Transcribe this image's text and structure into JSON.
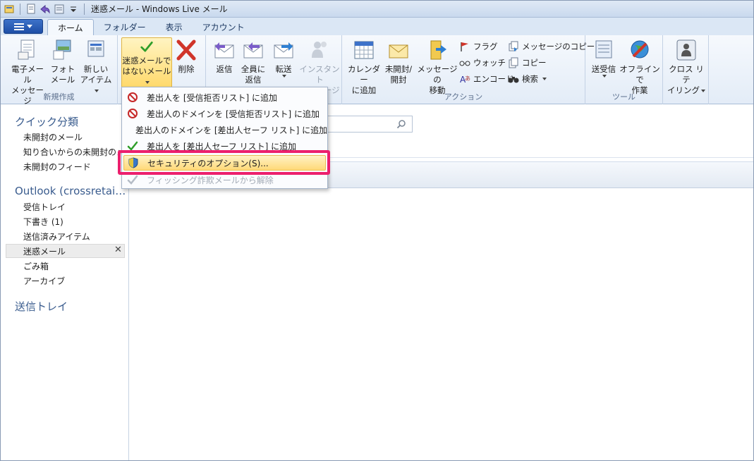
{
  "window": {
    "title": "迷惑メール - Windows Live メール"
  },
  "tabs": [
    {
      "label": "ホーム",
      "active": true
    },
    {
      "label": "フォルダー",
      "active": false
    },
    {
      "label": "表示",
      "active": false
    },
    {
      "label": "アカウント",
      "active": false
    }
  ],
  "ribbon": {
    "new_group": {
      "label": "新規作成",
      "email_line1": "電子メール",
      "email_line2": "メッセージ",
      "photo_line1": "フォト",
      "photo_line2": "メール",
      "newitem_line1": "新しい",
      "newitem_line2": "アイテム"
    },
    "delete_group": {
      "notjunk_line1": "迷惑メールで",
      "notjunk_line2": "はないメール",
      "delete": "削除"
    },
    "respond_group": {
      "reply": "返信",
      "replyall_line1": "全員に",
      "replyall_line2": "返信",
      "forward": "転送",
      "im_line1": "インスタント",
      "im_line2": "メッセージ"
    },
    "actions_group": {
      "label": "アクション",
      "calendar_line1": "カレンダー",
      "calendar_line2": "に追加",
      "unread_line1": "未開封/",
      "unread_line2": "開封",
      "move_line1": "メッセージの",
      "move_line2": "移動",
      "flag": "フラグ",
      "watch": "ウォッチ",
      "encode": "エンコード",
      "copy_message": "メッセージのコピー",
      "copy": "コピー",
      "find": "検索"
    },
    "tools_group": {
      "label": "ツール",
      "sendrecv": "送受信",
      "offline_line1": "オフラインで",
      "offline_line2": "作業"
    },
    "crossretailing": {
      "line1": "クロス リテ",
      "line2": "イリング"
    }
  },
  "sidebar": {
    "quick_views_title": "クイック分類",
    "quick_views": [
      "未開封のメール",
      "知り合いからの未開封のメ…",
      "未開封のフィード"
    ],
    "account_title": "Outlook (crossretai…",
    "folders": [
      "受信トレイ",
      "下書き (1)",
      "送信済みアイテム",
      "迷惑メール",
      "ごみ箱",
      "アーカイブ"
    ],
    "selected_folder": "迷惑メール",
    "outbox_title": "送信トレイ"
  },
  "menu": {
    "items": [
      {
        "label": "差出人を [受信拒否リスト] に追加",
        "icon": "block-icon",
        "disabled": false
      },
      {
        "label": "差出人のドメインを [受信拒否リスト] に追加",
        "icon": "block-icon",
        "disabled": false
      },
      {
        "label": "差出人のドメインを [差出人セーフ リスト] に追加",
        "icon": "check-icon",
        "disabled": false
      },
      {
        "label": "差出人を [差出人セーフ リスト] に追加",
        "icon": "check-icon",
        "disabled": false
      },
      {
        "label": "セキュリティのオプション(S)...",
        "icon": "shield-icon",
        "disabled": false,
        "highlighted": true
      },
      {
        "label": "フィッシング詐欺メールから解除",
        "icon": "check-icon",
        "disabled": true
      }
    ]
  },
  "colors": {
    "highlight_border": "#ec1f6d",
    "folder_header": "#3a5c8e",
    "check_green": "#2f9e2a",
    "block_red": "#c62828"
  }
}
